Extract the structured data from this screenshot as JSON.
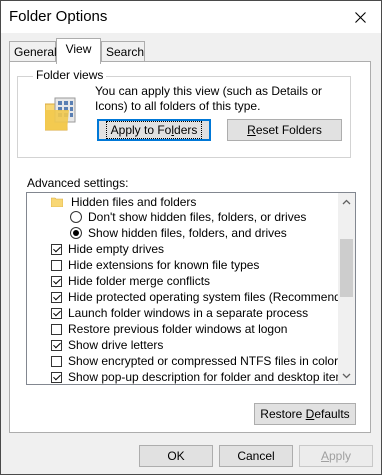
{
  "window": {
    "title": "Folder Options"
  },
  "tabs": [
    {
      "label": "General"
    },
    {
      "label": "View"
    },
    {
      "label": "Search"
    }
  ],
  "folder_views": {
    "group_label": "Folder views",
    "description": "You can apply this view (such as Details or Icons) to all folders of this type.",
    "apply_button": {
      "pre": "Apply to Fo",
      "accel": "l",
      "post": "ders"
    },
    "reset_button": {
      "pre": "",
      "accel": "R",
      "post": "eset Folders"
    }
  },
  "advanced": {
    "label": "Advanced settings:",
    "items": [
      {
        "kind": "folder",
        "label": "Hidden files and folders",
        "indent": 0
      },
      {
        "kind": "radio",
        "checked": false,
        "label": "Don't show hidden files, folders, or drives",
        "indent": 1
      },
      {
        "kind": "radio",
        "checked": true,
        "label": "Show hidden files, folders, and drives",
        "indent": 1
      },
      {
        "kind": "checkbox",
        "checked": true,
        "label": "Hide empty drives",
        "indent": 0
      },
      {
        "kind": "checkbox",
        "checked": false,
        "label": "Hide extensions for known file types",
        "indent": 0
      },
      {
        "kind": "checkbox",
        "checked": true,
        "label": "Hide folder merge conflicts",
        "indent": 0
      },
      {
        "kind": "checkbox",
        "checked": true,
        "label": "Hide protected operating system files (Recommended)",
        "indent": 0
      },
      {
        "kind": "checkbox",
        "checked": true,
        "label": "Launch folder windows in a separate process",
        "indent": 0
      },
      {
        "kind": "checkbox",
        "checked": false,
        "label": "Restore previous folder windows at logon",
        "indent": 0
      },
      {
        "kind": "checkbox",
        "checked": true,
        "label": "Show drive letters",
        "indent": 0
      },
      {
        "kind": "checkbox",
        "checked": false,
        "label": "Show encrypted or compressed NTFS files in color",
        "indent": 0
      },
      {
        "kind": "checkbox",
        "checked": true,
        "label": "Show pop-up description for folder and desktop items",
        "indent": 0
      }
    ]
  },
  "restore_defaults": {
    "pre": "Restore ",
    "accel": "D",
    "post": "efaults"
  },
  "footer": {
    "ok": "OK",
    "cancel": "Cancel",
    "apply": {
      "pre": "",
      "accel": "A",
      "post": "pply"
    }
  },
  "colors": {
    "accent": "#0078d7",
    "folder_yellow": "#f8d775",
    "disabled_text": "#a0a0a0"
  }
}
